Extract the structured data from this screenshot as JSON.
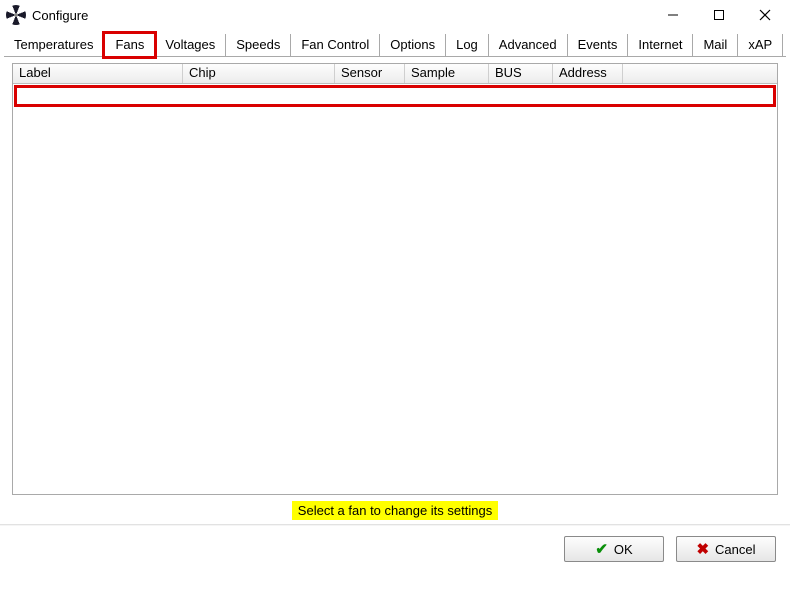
{
  "window": {
    "title": "Configure"
  },
  "tabs": [
    {
      "label": "Temperatures"
    },
    {
      "label": "Fans"
    },
    {
      "label": "Voltages"
    },
    {
      "label": "Speeds"
    },
    {
      "label": "Fan Control"
    },
    {
      "label": "Options"
    },
    {
      "label": "Log"
    },
    {
      "label": "Advanced"
    },
    {
      "label": "Events"
    },
    {
      "label": "Internet"
    },
    {
      "label": "Mail"
    },
    {
      "label": "xAP"
    }
  ],
  "columns": {
    "label": "Label",
    "chip": "Chip",
    "sensor": "Sensor",
    "sample": "Sample",
    "bus": "BUS",
    "address": "Address"
  },
  "hint": "Select a fan to change its settings",
  "buttons": {
    "ok": "OK",
    "cancel": "Cancel"
  }
}
